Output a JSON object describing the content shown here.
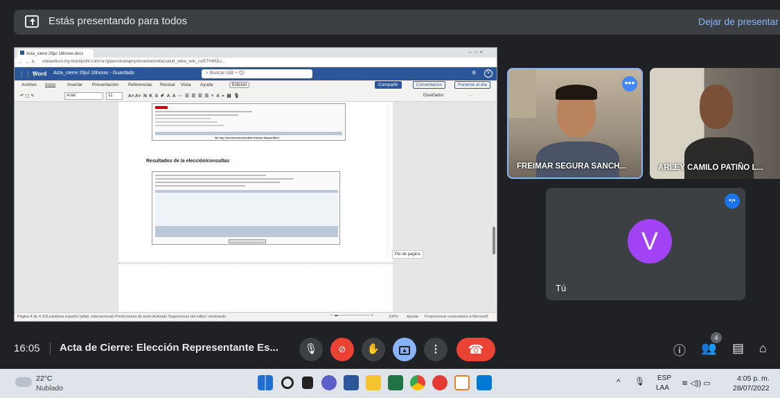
{
  "top": {
    "presenting_text": "Estás presentando para todos",
    "stop_label": "Dejar de presentar"
  },
  "shared": {
    "tab_title": "Acta_cierre 28jul 16horas.docx",
    "url": "udeaeduco-my.sharepoint.com/:w:/g/personal/apoyoinvestacionfacsalud_udea_edu_co/ETH8IDLl...",
    "word_app": "Word",
    "doc_name": "Acta_cierre 28jul 16horas - Guardado",
    "search_placeholder": "Buscar (Alt + Q)",
    "menu": [
      "Archivo",
      "Inicio",
      "Insertar",
      "Presentación",
      "Referencias",
      "Revisar",
      "Vista",
      "Ayuda",
      "Edición"
    ],
    "share": "Compartir",
    "comments": "Comentarios",
    "catchup": "Ponerse al día",
    "font": "Arial",
    "size": "11",
    "designer": "Diseñador",
    "doc_heading": "Resultados de la elección/consultas",
    "no_elections": "No hay elecciones/consultas futuras disponibles.",
    "footer_tag": "Pie de página",
    "status": "Página 4 de 4    316 palabras    español (alfab. internacional)    Predicciones de texto:Activado    Sugerencias del editor: mostrando",
    "zoom": "100%",
    "fit": "Ajustar",
    "feedback": "Proporcionar comentarios a Microsoft"
  },
  "participants": [
    {
      "name": "FREIMAR SEGURA SANCH..."
    },
    {
      "name": "ARLEY CAMILO PATIÑO L..."
    },
    {
      "name": "Tú",
      "initial": "V"
    }
  ],
  "meet": {
    "time": "16:05",
    "title": "Acta de Cierre: Elección Representante Es...",
    "people_count": "4"
  },
  "taskbar": {
    "temp": "22°C",
    "weather": "Nublado",
    "lang1": "ESP",
    "lang2": "LAA",
    "clock": "4:05 p. m.",
    "date": "28/07/2022"
  }
}
